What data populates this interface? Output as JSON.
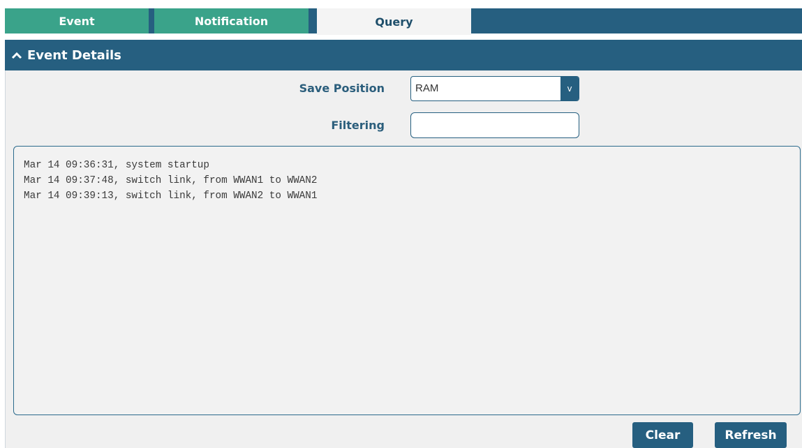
{
  "tabs": [
    {
      "label": "Event"
    },
    {
      "label": "Notification"
    },
    {
      "label": "Query"
    }
  ],
  "active_tab": "Query",
  "section": {
    "title": "Event Details",
    "icon": "chevron-up-icon"
  },
  "form": {
    "save_position": {
      "label": "Save Position",
      "value": "RAM",
      "arrow": "v"
    },
    "filtering": {
      "label": "Filtering",
      "value": ""
    }
  },
  "log": {
    "lines": [
      "Mar 14 09:36:31, system startup",
      "Mar 14 09:37:48, switch link, from WWAN1 to WWAN2",
      "Mar 14 09:39:13, switch link, from WWAN2 to WWAN1"
    ]
  },
  "buttons": {
    "clear": "Clear",
    "refresh": "Refresh"
  },
  "colors": {
    "primary": "#265f80",
    "tab_inactive": "#3aa38a",
    "panel_bg": "#f0f0f0"
  }
}
